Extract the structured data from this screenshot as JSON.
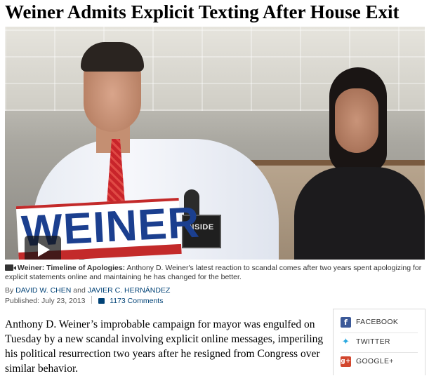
{
  "article": {
    "headline": "Weiner Admits Explicit Texting After House Exit",
    "media": {
      "sign_text": "WEINER",
      "mic_logo_text": "INSIDE",
      "play_button_icon": "play-icon"
    },
    "caption": {
      "title": "Weiner: Timeline of Apologies:",
      "text": "Anthony D. Weiner's latest reaction to scandal comes after two years spent apologizing for explicit statements online and maintaining he has changed for the better."
    },
    "byline": {
      "prefix": "By",
      "author1": "DAVID W. CHEN",
      "conjunction": "and",
      "author2": "JAVIER C. HERNÁNDEZ"
    },
    "published": "Published: July 23, 2013",
    "comments": "1173 Comments",
    "body": "Anthony D. Weiner’s improbable campaign for mayor was engulfed on Tuesday by a new scandal involving explicit online messages, imperiling his political resurrection two years after he resigned from Congress over similar behavior."
  },
  "share": {
    "facebook": "FACEBOOK",
    "twitter": "TWITTER",
    "google": "GOOGLE+"
  },
  "colors": {
    "link": "#004276",
    "facebook": "#3b5998",
    "twitter": "#2aa9e0",
    "google": "#d2462d"
  }
}
